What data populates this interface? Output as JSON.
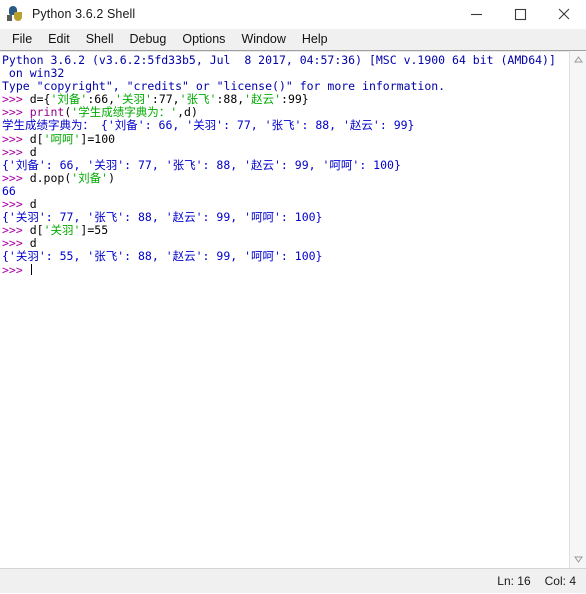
{
  "window": {
    "title": "Python 3.6.2 Shell",
    "icon": "python-logo-icon",
    "controls": {
      "minimize": "minimize-button",
      "maximize": "maximize-button",
      "close": "close-button"
    }
  },
  "menubar": {
    "items": [
      {
        "label": "File"
      },
      {
        "label": "Edit"
      },
      {
        "label": "Shell"
      },
      {
        "label": "Debug"
      },
      {
        "label": "Options"
      },
      {
        "label": "Window"
      },
      {
        "label": "Help"
      }
    ]
  },
  "console": {
    "lines": [
      {
        "segments": [
          {
            "text": "Python 3.6.2 (v3.6.2:5fd33b5, Jul  8 2017, 04:57:36) [MSC v.1900 64 bit (AMD64)]",
            "style": "banner"
          }
        ]
      },
      {
        "segments": [
          {
            "text": " on win32",
            "style": "banner"
          }
        ]
      },
      {
        "segments": [
          {
            "text": "Type \"copyright\", \"credits\" or \"license()\" for more information.",
            "style": "banner"
          }
        ]
      },
      {
        "segments": [
          {
            "text": ">>> ",
            "style": "prompt"
          },
          {
            "text": "d={",
            "style": "code"
          },
          {
            "text": "'刘备'",
            "style": "string"
          },
          {
            "text": ":66,",
            "style": "code"
          },
          {
            "text": "'关羽'",
            "style": "string"
          },
          {
            "text": ":77,",
            "style": "code"
          },
          {
            "text": "'张飞'",
            "style": "string"
          },
          {
            "text": ":88,",
            "style": "code"
          },
          {
            "text": "'赵云'",
            "style": "string"
          },
          {
            "text": ":99}",
            "style": "code"
          }
        ]
      },
      {
        "segments": [
          {
            "text": ">>> ",
            "style": "prompt"
          },
          {
            "text": "print",
            "style": "builtin"
          },
          {
            "text": "(",
            "style": "code"
          },
          {
            "text": "'学生成绩字典为：'",
            "style": "string"
          },
          {
            "text": ",d)",
            "style": "code"
          }
        ]
      },
      {
        "segments": [
          {
            "text": "学生成绩字典为： {'刘备': 66, '关羽': 77, '张飞': 88, '赵云': 99}",
            "style": "output"
          }
        ]
      },
      {
        "segments": [
          {
            "text": ">>> ",
            "style": "prompt"
          },
          {
            "text": "d[",
            "style": "code"
          },
          {
            "text": "'呵呵'",
            "style": "string"
          },
          {
            "text": "]=100",
            "style": "code"
          }
        ]
      },
      {
        "segments": [
          {
            "text": ">>> ",
            "style": "prompt"
          },
          {
            "text": "d",
            "style": "code"
          }
        ]
      },
      {
        "segments": [
          {
            "text": "{'刘备': 66, '关羽': 77, '张飞': 88, '赵云': 99, '呵呵': 100}",
            "style": "output"
          }
        ]
      },
      {
        "segments": [
          {
            "text": ">>> ",
            "style": "prompt"
          },
          {
            "text": "d.pop(",
            "style": "code"
          },
          {
            "text": "'刘备'",
            "style": "string"
          },
          {
            "text": ")",
            "style": "code"
          }
        ]
      },
      {
        "segments": [
          {
            "text": "66",
            "style": "output"
          }
        ]
      },
      {
        "segments": [
          {
            "text": ">>> ",
            "style": "prompt"
          },
          {
            "text": "d",
            "style": "code"
          }
        ]
      },
      {
        "segments": [
          {
            "text": "{'关羽': 77, '张飞': 88, '赵云': 99, '呵呵': 100}",
            "style": "output"
          }
        ]
      },
      {
        "segments": [
          {
            "text": ">>> ",
            "style": "prompt"
          },
          {
            "text": "d[",
            "style": "code"
          },
          {
            "text": "'关羽'",
            "style": "string"
          },
          {
            "text": "]=55",
            "style": "code"
          }
        ]
      },
      {
        "segments": [
          {
            "text": ">>> ",
            "style": "prompt"
          },
          {
            "text": "d",
            "style": "code"
          }
        ]
      },
      {
        "segments": [
          {
            "text": "{'关羽': 55, '张飞': 88, '赵云': 99, '呵呵': 100}",
            "style": "output"
          }
        ]
      },
      {
        "segments": [
          {
            "text": ">>> ",
            "style": "prompt"
          },
          {
            "text": "",
            "style": "code",
            "caret": true
          }
        ]
      }
    ]
  },
  "scrollbar": {
    "up_arrow": "scroll-up-arrow-icon",
    "down_arrow": "scroll-down-arrow-icon"
  },
  "statusbar": {
    "line_label": "Ln: 16",
    "col_label": "Col: 4"
  },
  "colors": {
    "banner": "#0000aa",
    "prompt": "#aa00aa",
    "code": "#000000",
    "string": "#00aa00",
    "builtin": "#900090",
    "output": "#0000cc",
    "menubar_bg": "#f0f0f0",
    "statusbar_bg": "#f0f0f0"
  }
}
